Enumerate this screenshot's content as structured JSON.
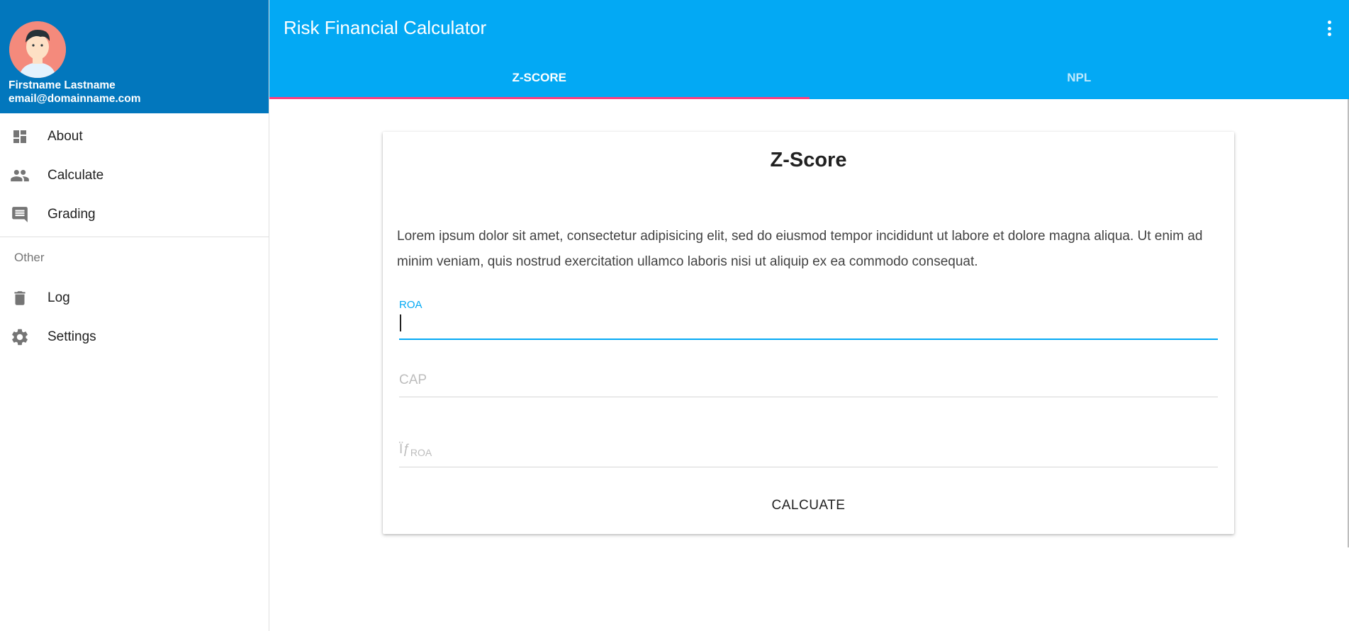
{
  "profile": {
    "name": "Firstname Lastname",
    "email": "email@domainname.com"
  },
  "sidebar": {
    "items": [
      {
        "label": "About",
        "icon": "dashboard-icon"
      },
      {
        "label": "Calculate",
        "icon": "people-icon"
      },
      {
        "label": "Grading",
        "icon": "comment-icon"
      }
    ],
    "subheader": "Other",
    "other_items": [
      {
        "label": "Log",
        "icon": "trash-icon"
      },
      {
        "label": "Settings",
        "icon": "gear-icon"
      }
    ]
  },
  "header": {
    "title": "Risk Financial Calculator",
    "menu_icon": "more-vert-icon"
  },
  "tabs": [
    {
      "label": "Z-SCORE",
      "active": true
    },
    {
      "label": "NPL",
      "active": false
    }
  ],
  "card": {
    "title": "Z-Score",
    "description": "Lorem ipsum dolor sit amet, consectetur adipisicing elit, sed do eiusmod tempor incididunt ut labore et dolore magna aliqua. Ut enim ad minim veniam, quis nostrud exercitation ullamco laboris nisi ut aliquip ex ea commodo consequat.",
    "fields": {
      "roa": {
        "label": "ROA",
        "value": ""
      },
      "cap": {
        "placeholder": "CAP",
        "value": ""
      },
      "sigma_roa": {
        "placeholder_main": "Ïƒ",
        "placeholder_sub": "ROA",
        "value": ""
      }
    },
    "button_label": "CALCUATE"
  },
  "colors": {
    "primary": "#03a9f4",
    "primary_dark": "#0277bd",
    "accent": "#ff4081"
  }
}
